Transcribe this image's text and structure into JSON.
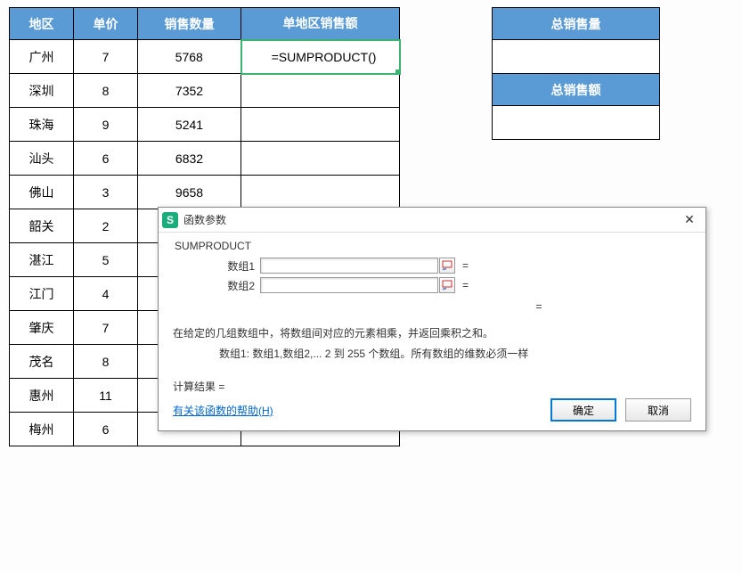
{
  "main_table": {
    "headers": {
      "region": "地区",
      "price": "单价",
      "qty": "销售数量",
      "sales": "单地区销售额"
    },
    "rows": [
      {
        "region": "广州",
        "price": "7",
        "qty": "5768",
        "sales": "=SUMPRODUCT()"
      },
      {
        "region": "深圳",
        "price": "8",
        "qty": "7352",
        "sales": ""
      },
      {
        "region": "珠海",
        "price": "9",
        "qty": "5241",
        "sales": ""
      },
      {
        "region": "汕头",
        "price": "6",
        "qty": "6832",
        "sales": ""
      },
      {
        "region": "佛山",
        "price": "3",
        "qty": "9658",
        "sales": ""
      },
      {
        "region": "韶关",
        "price": "2",
        "qty": "",
        "sales": ""
      },
      {
        "region": "湛江",
        "price": "5",
        "qty": "",
        "sales": ""
      },
      {
        "region": "江门",
        "price": "4",
        "qty": "",
        "sales": ""
      },
      {
        "region": "肇庆",
        "price": "7",
        "qty": "",
        "sales": ""
      },
      {
        "region": "茂名",
        "price": "8",
        "qty": "",
        "sales": ""
      },
      {
        "region": "惠州",
        "price": "11",
        "qty": "",
        "sales": ""
      },
      {
        "region": "梅州",
        "price": "6",
        "qty": "",
        "sales": ""
      }
    ]
  },
  "side_table": {
    "label_total_qty": "总销售量",
    "value_total_qty": "",
    "label_total_sales": "总销售额",
    "value_total_sales": ""
  },
  "dialog": {
    "title": "函数参数",
    "func_name": "SUMPRODUCT",
    "param1_label": "数组1",
    "param1_value": "",
    "param2_label": "数组2",
    "param2_value": "",
    "eq": "=",
    "desc_main": "在给定的几组数组中，将数组间对应的元素相乘，并返回乘积之和。",
    "desc_sub": "数组1:  数组1,数组2,... 2 到 255 个数组。所有数组的维数必须一样",
    "calc_label": "计算结果 =",
    "help_link": "有关该函数的帮助(H)",
    "ok": "确定",
    "cancel": "取消"
  }
}
